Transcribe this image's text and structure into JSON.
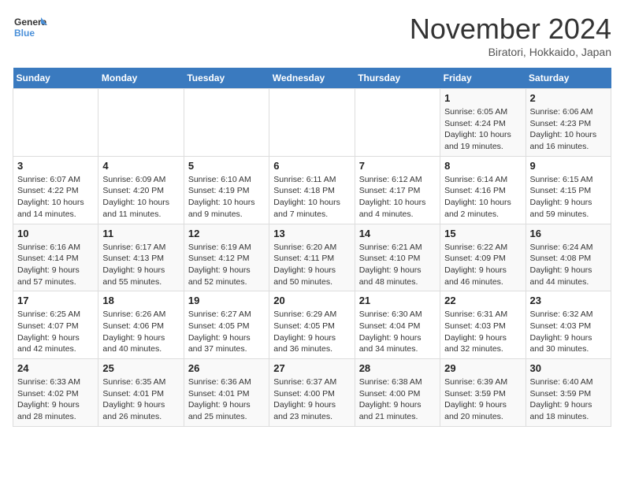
{
  "logo": {
    "line1": "General",
    "line2": "Blue"
  },
  "title": "November 2024",
  "subtitle": "Biratori, Hokkaido, Japan",
  "weekdays": [
    "Sunday",
    "Monday",
    "Tuesday",
    "Wednesday",
    "Thursday",
    "Friday",
    "Saturday"
  ],
  "weeks": [
    [
      {
        "day": "",
        "info": ""
      },
      {
        "day": "",
        "info": ""
      },
      {
        "day": "",
        "info": ""
      },
      {
        "day": "",
        "info": ""
      },
      {
        "day": "",
        "info": ""
      },
      {
        "day": "1",
        "info": "Sunrise: 6:05 AM\nSunset: 4:24 PM\nDaylight: 10 hours\nand 19 minutes."
      },
      {
        "day": "2",
        "info": "Sunrise: 6:06 AM\nSunset: 4:23 PM\nDaylight: 10 hours\nand 16 minutes."
      }
    ],
    [
      {
        "day": "3",
        "info": "Sunrise: 6:07 AM\nSunset: 4:22 PM\nDaylight: 10 hours\nand 14 minutes."
      },
      {
        "day": "4",
        "info": "Sunrise: 6:09 AM\nSunset: 4:20 PM\nDaylight: 10 hours\nand 11 minutes."
      },
      {
        "day": "5",
        "info": "Sunrise: 6:10 AM\nSunset: 4:19 PM\nDaylight: 10 hours\nand 9 minutes."
      },
      {
        "day": "6",
        "info": "Sunrise: 6:11 AM\nSunset: 4:18 PM\nDaylight: 10 hours\nand 7 minutes."
      },
      {
        "day": "7",
        "info": "Sunrise: 6:12 AM\nSunset: 4:17 PM\nDaylight: 10 hours\nand 4 minutes."
      },
      {
        "day": "8",
        "info": "Sunrise: 6:14 AM\nSunset: 4:16 PM\nDaylight: 10 hours\nand 2 minutes."
      },
      {
        "day": "9",
        "info": "Sunrise: 6:15 AM\nSunset: 4:15 PM\nDaylight: 9 hours\nand 59 minutes."
      }
    ],
    [
      {
        "day": "10",
        "info": "Sunrise: 6:16 AM\nSunset: 4:14 PM\nDaylight: 9 hours\nand 57 minutes."
      },
      {
        "day": "11",
        "info": "Sunrise: 6:17 AM\nSunset: 4:13 PM\nDaylight: 9 hours\nand 55 minutes."
      },
      {
        "day": "12",
        "info": "Sunrise: 6:19 AM\nSunset: 4:12 PM\nDaylight: 9 hours\nand 52 minutes."
      },
      {
        "day": "13",
        "info": "Sunrise: 6:20 AM\nSunset: 4:11 PM\nDaylight: 9 hours\nand 50 minutes."
      },
      {
        "day": "14",
        "info": "Sunrise: 6:21 AM\nSunset: 4:10 PM\nDaylight: 9 hours\nand 48 minutes."
      },
      {
        "day": "15",
        "info": "Sunrise: 6:22 AM\nSunset: 4:09 PM\nDaylight: 9 hours\nand 46 minutes."
      },
      {
        "day": "16",
        "info": "Sunrise: 6:24 AM\nSunset: 4:08 PM\nDaylight: 9 hours\nand 44 minutes."
      }
    ],
    [
      {
        "day": "17",
        "info": "Sunrise: 6:25 AM\nSunset: 4:07 PM\nDaylight: 9 hours\nand 42 minutes."
      },
      {
        "day": "18",
        "info": "Sunrise: 6:26 AM\nSunset: 4:06 PM\nDaylight: 9 hours\nand 40 minutes."
      },
      {
        "day": "19",
        "info": "Sunrise: 6:27 AM\nSunset: 4:05 PM\nDaylight: 9 hours\nand 37 minutes."
      },
      {
        "day": "20",
        "info": "Sunrise: 6:29 AM\nSunset: 4:05 PM\nDaylight: 9 hours\nand 36 minutes."
      },
      {
        "day": "21",
        "info": "Sunrise: 6:30 AM\nSunset: 4:04 PM\nDaylight: 9 hours\nand 34 minutes."
      },
      {
        "day": "22",
        "info": "Sunrise: 6:31 AM\nSunset: 4:03 PM\nDaylight: 9 hours\nand 32 minutes."
      },
      {
        "day": "23",
        "info": "Sunrise: 6:32 AM\nSunset: 4:03 PM\nDaylight: 9 hours\nand 30 minutes."
      }
    ],
    [
      {
        "day": "24",
        "info": "Sunrise: 6:33 AM\nSunset: 4:02 PM\nDaylight: 9 hours\nand 28 minutes."
      },
      {
        "day": "25",
        "info": "Sunrise: 6:35 AM\nSunset: 4:01 PM\nDaylight: 9 hours\nand 26 minutes."
      },
      {
        "day": "26",
        "info": "Sunrise: 6:36 AM\nSunset: 4:01 PM\nDaylight: 9 hours\nand 25 minutes."
      },
      {
        "day": "27",
        "info": "Sunrise: 6:37 AM\nSunset: 4:00 PM\nDaylight: 9 hours\nand 23 minutes."
      },
      {
        "day": "28",
        "info": "Sunrise: 6:38 AM\nSunset: 4:00 PM\nDaylight: 9 hours\nand 21 minutes."
      },
      {
        "day": "29",
        "info": "Sunrise: 6:39 AM\nSunset: 3:59 PM\nDaylight: 9 hours\nand 20 minutes."
      },
      {
        "day": "30",
        "info": "Sunrise: 6:40 AM\nSunset: 3:59 PM\nDaylight: 9 hours\nand 18 minutes."
      }
    ]
  ]
}
